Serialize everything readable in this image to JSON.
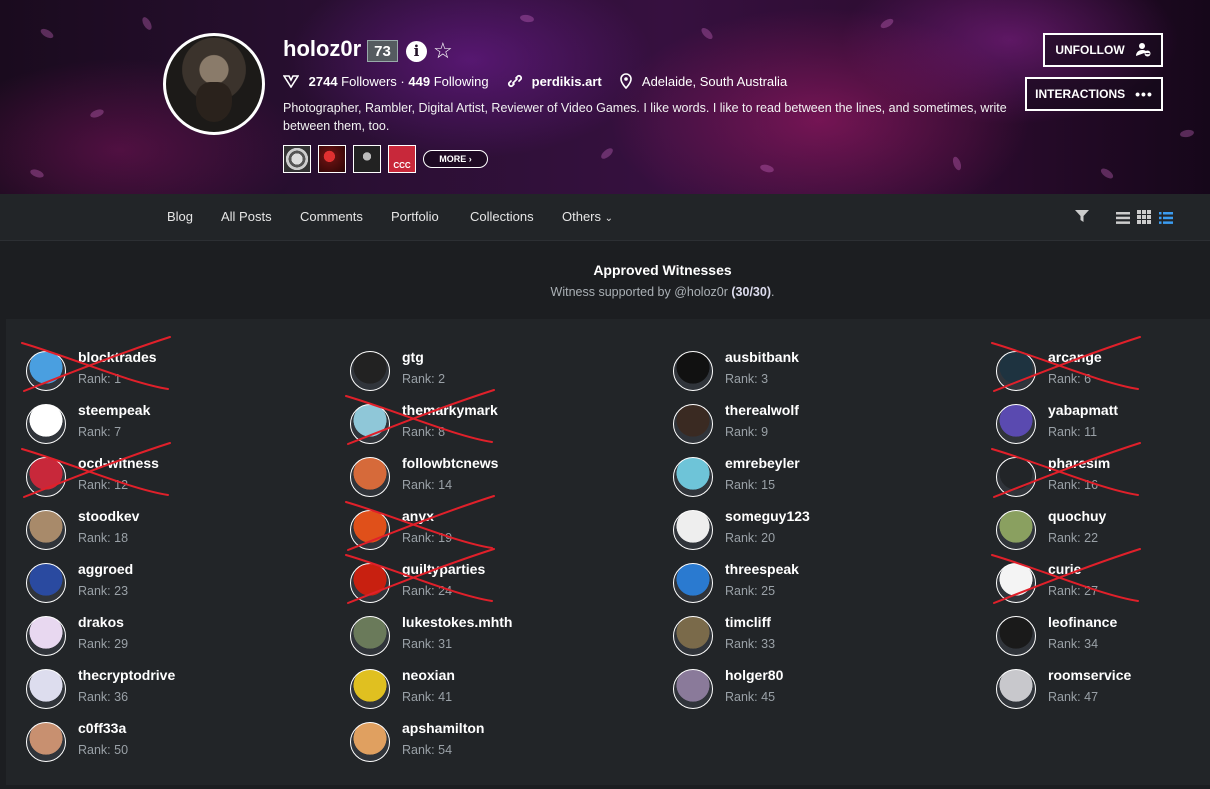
{
  "profile": {
    "username": "holoz0r",
    "reputation": "73",
    "followers_count": "2744",
    "followers_label": "Followers",
    "separator": "·",
    "following_count": "449",
    "following_label": "Following",
    "website": "perdikis.art",
    "location": "Adelaide, South Australia",
    "bio": "Photographer, Rambler, Digital Artist, Reviewer of Video Games. I like words. I like to read between the lines, and sometimes, write between them, too.",
    "more_label": "MORE",
    "badge4_text": "CCC"
  },
  "actions": {
    "unfollow_label": "UNFOLLOW",
    "interactions_label": "INTERACTIONS"
  },
  "nav": {
    "items": [
      "Blog",
      "All Posts",
      "Comments",
      "Portfolio",
      "Collections",
      "Others"
    ]
  },
  "witnesses": {
    "title": "Approved Witnesses",
    "subtitle_prefix": "Witness supported by @holoz0r ",
    "subtitle_count": "(30/30)",
    "subtitle_suffix": ".",
    "list": [
      {
        "name": "blocktrades",
        "rank": "Rank: 1",
        "crossed": true,
        "color": "#4a9fe0"
      },
      {
        "name": "gtg",
        "rank": "Rank: 2",
        "crossed": false,
        "color": "#222"
      },
      {
        "name": "ausbitbank",
        "rank": "Rank: 3",
        "crossed": false,
        "color": "#111"
      },
      {
        "name": "arcange",
        "rank": "Rank: 6",
        "crossed": true,
        "color": "#1e3340"
      },
      {
        "name": "steempeak",
        "rank": "Rank: 7",
        "crossed": false,
        "color": "#fff"
      },
      {
        "name": "themarkymark",
        "rank": "Rank: 8",
        "crossed": true,
        "color": "#8fc7d8"
      },
      {
        "name": "therealwolf",
        "rank": "Rank: 9",
        "crossed": false,
        "color": "#3a2a22"
      },
      {
        "name": "yabapmatt",
        "rank": "Rank: 11",
        "crossed": false,
        "color": "#5a4ab0"
      },
      {
        "name": "ocd-witness",
        "rank": "Rank: 12",
        "crossed": true,
        "color": "#c8283a"
      },
      {
        "name": "followbtcnews",
        "rank": "Rank: 14",
        "crossed": false,
        "color": "#d66a3a"
      },
      {
        "name": "emrebeyler",
        "rank": "Rank: 15",
        "crossed": false,
        "color": "#6ec4d8"
      },
      {
        "name": "pharesim",
        "rank": "Rank: 16",
        "crossed": true,
        "color": "#222528"
      },
      {
        "name": "stoodkev",
        "rank": "Rank: 18",
        "crossed": false,
        "color": "#a88a6a"
      },
      {
        "name": "anyx",
        "rank": "Rank: 19",
        "crossed": true,
        "color": "#e0501a"
      },
      {
        "name": "someguy123",
        "rank": "Rank: 20",
        "crossed": false,
        "color": "#eee"
      },
      {
        "name": "quochuy",
        "rank": "Rank: 22",
        "crossed": false,
        "color": "#8aa060"
      },
      {
        "name": "aggroed",
        "rank": "Rank: 23",
        "crossed": false,
        "color": "#2a4aa0"
      },
      {
        "name": "guiltyparties",
        "rank": "Rank: 24",
        "crossed": true,
        "color": "#c82010"
      },
      {
        "name": "threespeak",
        "rank": "Rank: 25",
        "crossed": false,
        "color": "#2a7ad0"
      },
      {
        "name": "curie",
        "rank": "Rank: 27",
        "crossed": true,
        "color": "#f4f4f4"
      },
      {
        "name": "drakos",
        "rank": "Rank: 29",
        "crossed": false,
        "color": "#e8d8f0"
      },
      {
        "name": "lukestokes.mhth",
        "rank": "Rank: 31",
        "crossed": false,
        "color": "#6a7a5a"
      },
      {
        "name": "timcliff",
        "rank": "Rank: 33",
        "crossed": false,
        "color": "#7a6a4a"
      },
      {
        "name": "leofinance",
        "rank": "Rank: 34",
        "crossed": false,
        "color": "#1a1a1a"
      },
      {
        "name": "thecryptodrive",
        "rank": "Rank: 36",
        "crossed": false,
        "color": "#dde"
      },
      {
        "name": "neoxian",
        "rank": "Rank: 41",
        "crossed": false,
        "color": "#e0c020"
      },
      {
        "name": "holger80",
        "rank": "Rank: 45",
        "crossed": false,
        "color": "#8a7a9a"
      },
      {
        "name": "roomservice",
        "rank": "Rank: 47",
        "crossed": false,
        "color": "#c8c8cc"
      },
      {
        "name": "c0ff33a",
        "rank": "Rank: 50",
        "crossed": false,
        "color": "#c89070"
      },
      {
        "name": "apshamilton",
        "rank": "Rank: 54",
        "crossed": false,
        "color": "#e0a060"
      }
    ]
  }
}
